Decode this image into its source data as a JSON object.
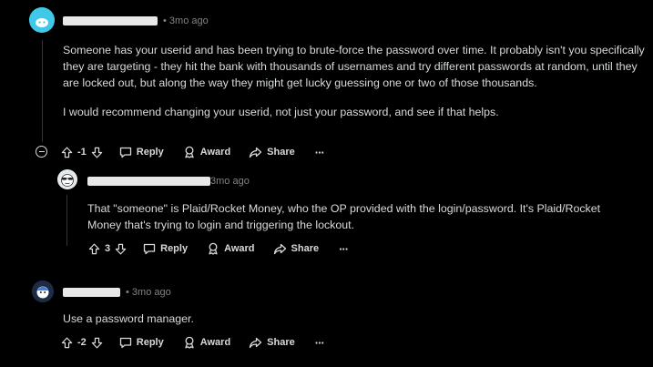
{
  "comments": [
    {
      "time": "3mo ago",
      "body": [
        "Someone has your userid and has been trying to brute-force the password over time. It probably isn't you specifically they are targeting - they hit the bank with thousands of usernames and try different passwords at random, until they are locked out, but along the way they might get lucky guessing one or two of those thousands.",
        "I would recommend changing your userid, not just your password, and see if that helps."
      ],
      "score": "-1",
      "reply_label": "Reply",
      "award_label": "Award",
      "share_label": "Share",
      "more_label": "···"
    },
    {
      "time": "3mo ago",
      "body": [
        "That \"someone\" is Plaid/Rocket Money, who the OP provided with the login/password. It's Plaid/Rocket Money that's trying to login and triggering the lockout."
      ],
      "score": "3",
      "reply_label": "Reply",
      "award_label": "Award",
      "share_label": "Share",
      "more_label": "···"
    },
    {
      "time": "3mo ago",
      "body": [
        "Use a password manager."
      ],
      "score": "-2",
      "reply_label": "Reply",
      "award_label": "Award",
      "share_label": "Share",
      "more_label": "···"
    }
  ],
  "colors": {
    "background": "#000000",
    "text": "#d7dadc",
    "meta": "#818384",
    "thread_line": "#343536",
    "avatar1": "#3fc8e8"
  }
}
